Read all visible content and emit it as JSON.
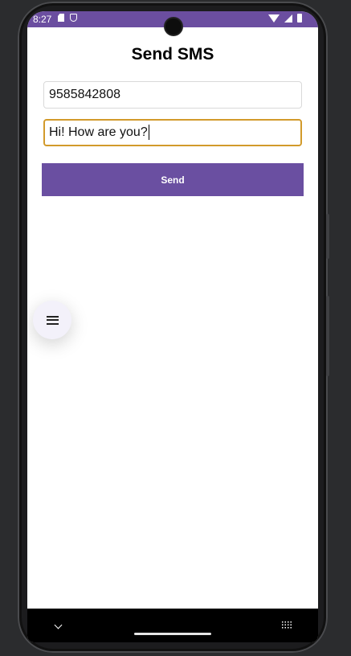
{
  "status_bar": {
    "time": "8:27",
    "left_icons": [
      "sd-card-icon",
      "shield-icon"
    ],
    "right_icons": [
      "wifi-icon",
      "signal-icon",
      "battery-icon"
    ],
    "color": "#6b4ea0"
  },
  "header": {
    "title": "Send SMS"
  },
  "form": {
    "phone": {
      "value": "9585842808"
    },
    "message": {
      "value": "Hi! How are you?"
    },
    "send_label": "Send",
    "accent": "#6a4fa1",
    "focus_border": "#d29a2b"
  },
  "fab": {
    "icon": "menu-icon"
  },
  "nav_bar": {
    "left_icon": "chevron-down-icon",
    "right_icon": "keyboard-icon"
  }
}
